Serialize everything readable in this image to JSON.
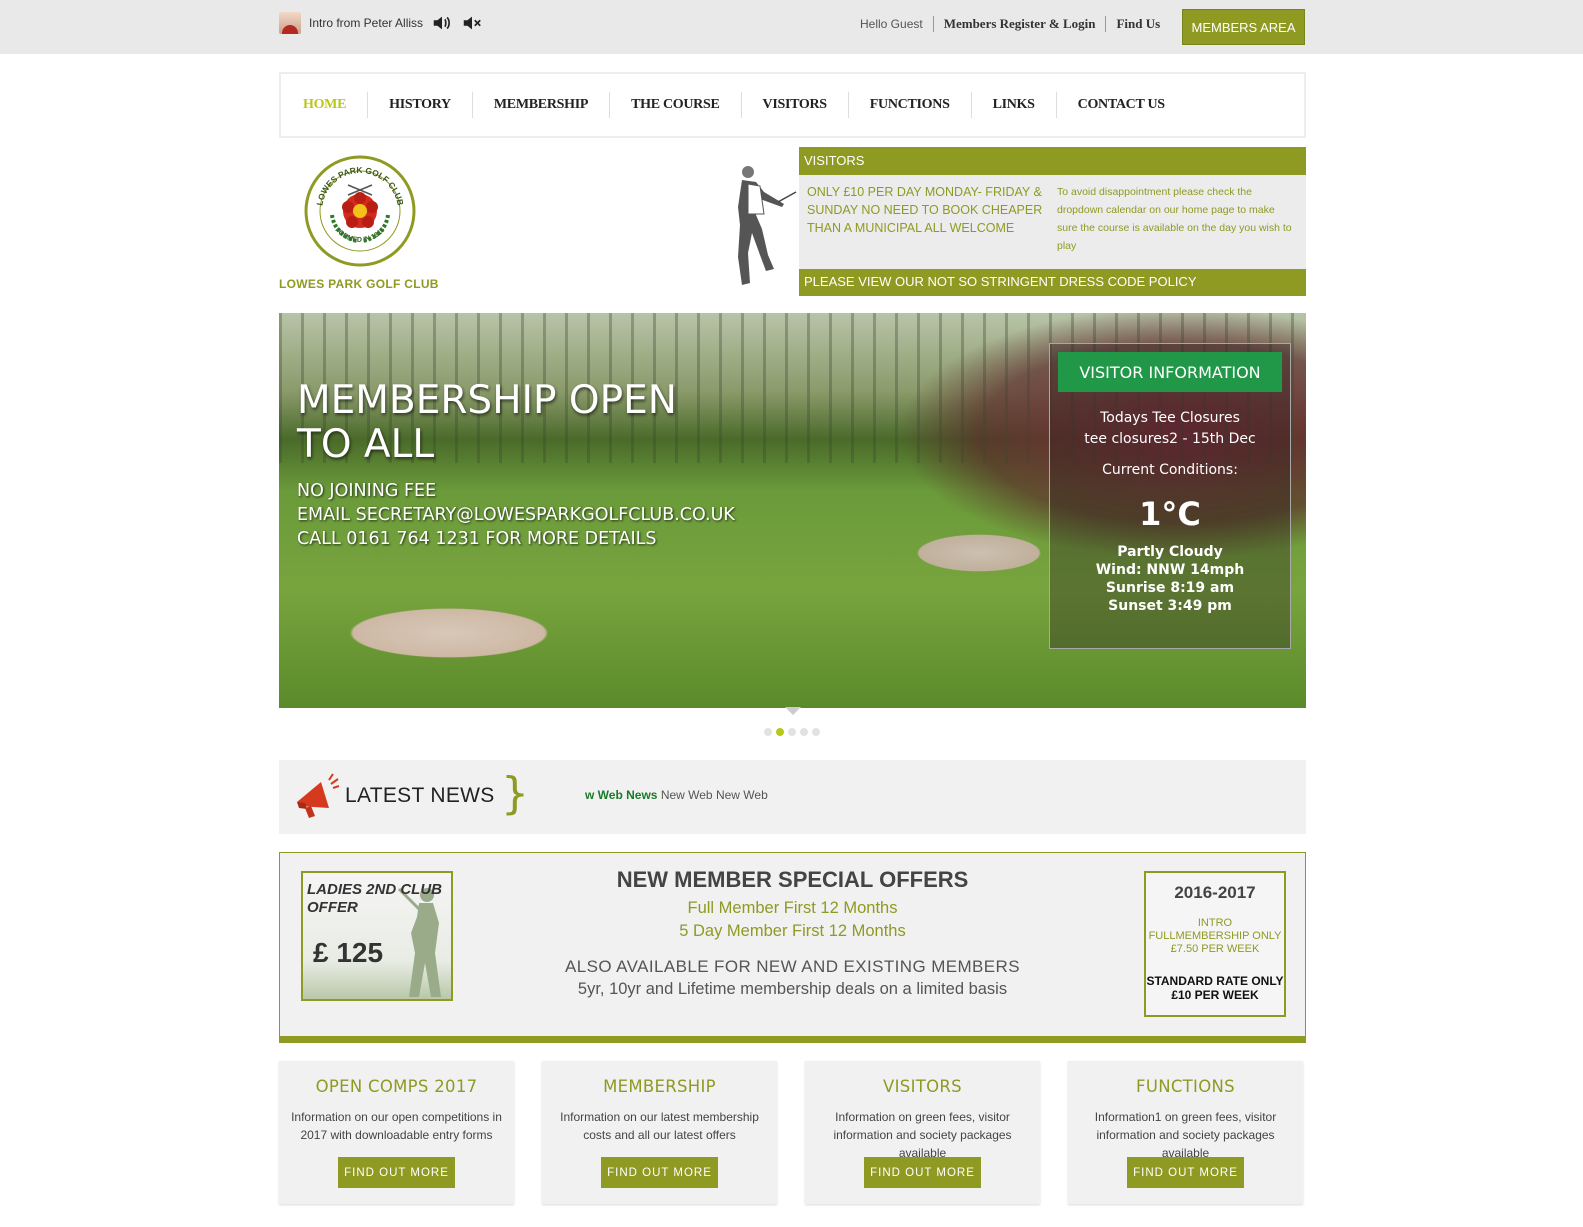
{
  "topbar": {
    "intro_label": "Intro from Peter Alliss",
    "greeting": "Hello Guest",
    "register_label": "Members Register & Login",
    "find_us_label": "Find Us",
    "members_area_label": "MEMBERS AREA"
  },
  "nav": {
    "items": [
      "HOME",
      "HISTORY",
      "MEMBERSHIP",
      "THE COURSE",
      "VISITORS",
      "FUNCTIONS",
      "LINKS",
      "CONTACT US"
    ]
  },
  "logo": {
    "ring_text_top": "LOWES PARK GOLF CLUB",
    "ring_text_bottom": "FORMED IN 1915",
    "club_name": "LOWES PARK GOLF CLUB"
  },
  "visitors_panel": {
    "heading": "VISITORS",
    "offer": "ONLY £10 PER DAY MONDAY- FRIDAY & SUNDAY NO NEED TO BOOK CHEAPER THAN A MUNICIPAL ALL WELCOME",
    "note": "To avoid disappointment please check the dropdown calendar on our home page to make sure the course is available on the day you wish to play",
    "dress_code": "PLEASE VIEW OUR NOT SO STRINGENT DRESS CODE POLICY"
  },
  "hero": {
    "title": "MEMBERSHIP OPEN TO ALL",
    "line1": "NO JOINING FEE",
    "line2": "EMAIL SECRETARY@LOWESPARKGOLFCLUB.CO.UK",
    "line3": "CALL 0161 764 1231 FOR MORE DETAILS",
    "info": {
      "button_label": "VISITOR INFORMATION",
      "tee_title": "Todays Tee Closures",
      "tee_value": "tee closures2 - 15th Dec",
      "conditions_label": "Current Conditions:",
      "temperature": "1°C",
      "sky": "Partly Cloudy",
      "wind": "Wind: NNW 14mph",
      "sunrise": "Sunrise 8:19 am",
      "sunset": "Sunset 3:49 pm"
    },
    "slide_count": 5,
    "active_slide": 2
  },
  "news": {
    "title": "LATEST NEWS",
    "ticker_bold": "w Web News",
    "ticker_rest": "New Web New Web"
  },
  "offers": {
    "ladies_title": "LADIES 2ND CLUB OFFER",
    "ladies_price": "£ 125",
    "title": "NEW MEMBER SPECIAL OFFERS",
    "sub1": "Full Member First 12 Months",
    "sub2": "5 Day Member First 12 Months",
    "also": "ALSO AVAILABLE FOR NEW AND EXISTING MEMBERS",
    "also2": "5yr, 10yr and Lifetime membership deals on a limited basis",
    "box_year": "2016-2017",
    "box_intro": "INTRO FULLMEMBERSHIP ONLY £7.50 PER WEEK",
    "box_standard": "STANDARD RATE ONLY £10 PER WEEK"
  },
  "cards": [
    {
      "title": "OPEN COMPS 2017",
      "desc": "Information on our open competitions in 2017 with downloadable entry forms",
      "button": "FIND OUT MORE"
    },
    {
      "title": "MEMBERSHIP",
      "desc": "Information on our latest membership costs and all our latest offers",
      "button": "FIND OUT MORE"
    },
    {
      "title": "VISITORS",
      "desc": "Information on green fees, visitor information and society packages available",
      "button": "FIND OUT MORE"
    },
    {
      "title": "FUNCTIONS",
      "desc": "Information1 on green fees, visitor information and society packages available",
      "button": "FIND OUT MORE"
    }
  ],
  "colors": {
    "accent": "#8f9a23",
    "nav_active": "#b7c81a",
    "visitor_button": "#209848"
  },
  "icons": {
    "avatar": "avatar-icon",
    "speaker": "speaker-icon",
    "mute": "mute-icon",
    "megaphone": "megaphone-icon"
  }
}
